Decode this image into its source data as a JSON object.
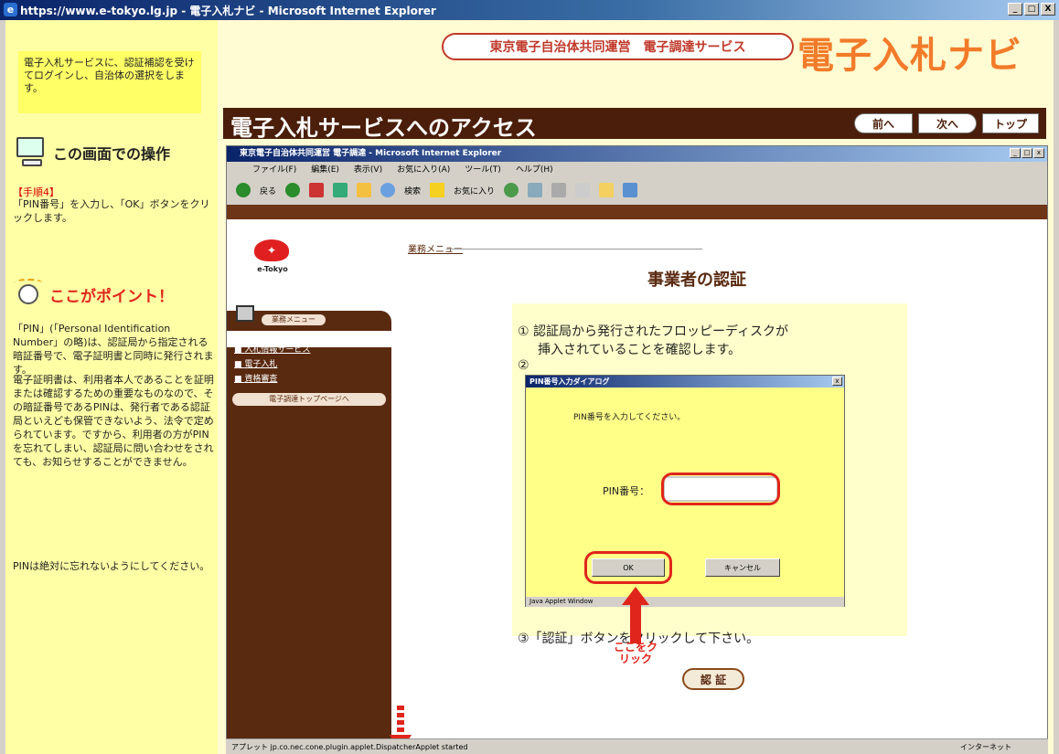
{
  "browser": {
    "title": "https://www.e-tokyo.lg.jp - 電子入札ナビ - Microsoft Internet Explorer",
    "buttons": [
      "_",
      "□",
      "X"
    ]
  },
  "left": {
    "note": "電子入札サービスに、認証補認を受けてログインし、自治体の選択をします。",
    "ops_title": "この画面での操作",
    "step_label": "【手順4】",
    "step_text": "「PIN番号」を入力し、「OK」ボタンをクリックします。",
    "point_title": "ここがポイント！",
    "para1": "「PIN」(「Personal Identification Number」の略)は、認証局から指定される暗証番号で、電子証明書と同時に発行されます。",
    "para2": "電子証明書は、利用者本人であることを証明または確認するための重要なものなので、その暗証番号であるPINは、発行者である認証局といえども保管できないよう、法令で定められています。ですから、利用者の方がPINを忘れてしまい、認証局に問い合わせをされても、お知らせすることができません。",
    "para3": "PINは絶対に忘れないようにしてください。"
  },
  "header": {
    "service_pill": "東京電子自治体共同運営　電子調達サービス",
    "brand": "電子入札ナビ",
    "section_title": "電子入札サービスへのアクセス",
    "prev": "前へ",
    "next": "次へ",
    "top": "トップ"
  },
  "inner": {
    "title": "東京電子自治体共同運営 電子調達 - Microsoft Internet Explorer",
    "menu": [
      "ファイル(F)",
      "編集(E)",
      "表示(V)",
      "お気に入り(A)",
      "ツール(T)",
      "ヘルプ(H)"
    ],
    "toolbar_back": "戻る",
    "toolbar_search": "検索",
    "toolbar_fav": "お気に入り",
    "etokyo": "e-Tokyo",
    "gyomu_menu": "業務メニュー",
    "side_links": [
      "入札情報サービス",
      "電子入札",
      "資格審査"
    ],
    "side_portal": "電子調達トップページへ",
    "crumb": "業務メニュー",
    "page_heading": "事業者の認証",
    "inst1": "① 認証局から発行されたフロッピーディスクが",
    "inst1b": "挿入されていることを確認します。",
    "inst2": "②",
    "inst3": "③「認証」ボタンをクリックして下さい。",
    "auth_button": "認 証",
    "status": "アプレット jp.co.nec.cone.plugin.applet.DispatcherApplet started",
    "zone": "インターネット"
  },
  "dialog": {
    "title": "PIN番号入力ダイアログ",
    "message": "PIN番号を入力してください。",
    "pin_label": "PIN番号：",
    "pin_value": "",
    "ok": "OK",
    "cancel": "キャンセル",
    "applet_window": "Java Applet Window"
  },
  "annotation": {
    "click_here": "ここをクリック"
  }
}
